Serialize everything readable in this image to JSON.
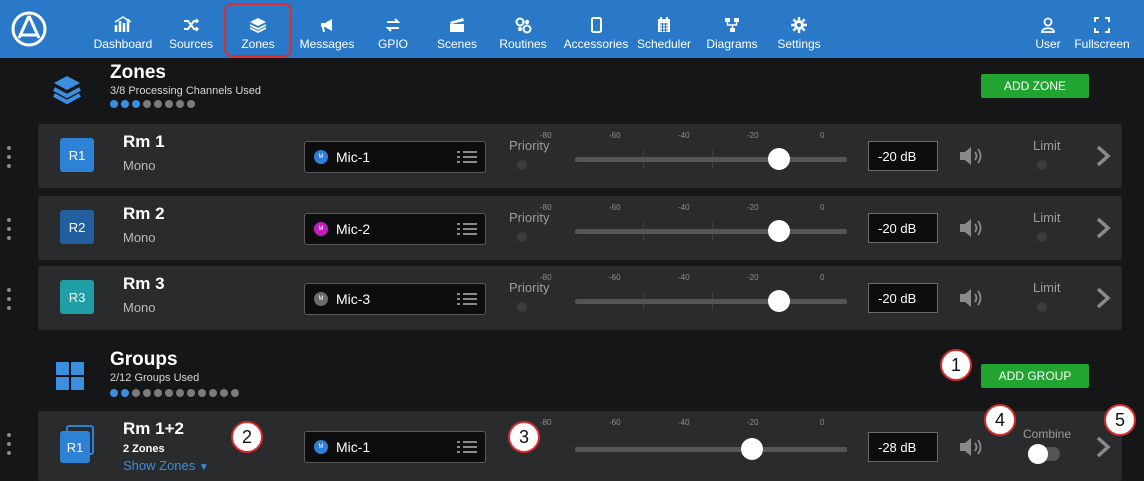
{
  "nav": {
    "items": [
      {
        "label": "Dashboard",
        "icon": "dashboard-icon"
      },
      {
        "label": "Sources",
        "icon": "sources-icon"
      },
      {
        "label": "Zones",
        "icon": "zones-icon",
        "active": true
      },
      {
        "label": "Messages",
        "icon": "messages-icon"
      },
      {
        "label": "GPIO",
        "icon": "gpio-icon"
      },
      {
        "label": "Scenes",
        "icon": "scenes-icon"
      },
      {
        "label": "Routines",
        "icon": "routines-icon"
      },
      {
        "label": "Accessories",
        "icon": "accessories-icon"
      },
      {
        "label": "Scheduler",
        "icon": "scheduler-icon"
      },
      {
        "label": "Diagrams",
        "icon": "diagrams-icon"
      },
      {
        "label": "Settings",
        "icon": "settings-icon"
      }
    ],
    "user": {
      "label": "User",
      "icon": "user-icon"
    },
    "fullscreen": {
      "label": "Fullscreen",
      "icon": "fullscreen-icon"
    }
  },
  "zones": {
    "title": "Zones",
    "subtitle": "3/8 Processing Channels Used",
    "used": 3,
    "total": 8,
    "add_label": "ADD ZONE",
    "priority_label": "Priority",
    "limit_label": "Limit",
    "scale": [
      "-80",
      "-60",
      "-40",
      "-20",
      "0"
    ],
    "rows": [
      {
        "badge": "R1",
        "name": "Rm 1",
        "mode": "Mono",
        "source": "Mic-1",
        "source_tag": "M",
        "source_color": "#2f7fd8",
        "badge_color": "#2d82d6",
        "level": "-20 dB",
        "fader_fraction": 0.75
      },
      {
        "badge": "R2",
        "name": "Rm 2",
        "mode": "Mono",
        "source": "Mic-2",
        "source_tag": "M",
        "source_color": "#c11dbd",
        "badge_color": "#235f9e",
        "level": "-20 dB",
        "fader_fraction": 0.75
      },
      {
        "badge": "R3",
        "name": "Rm 3",
        "mode": "Mono",
        "source": "Mic-3",
        "source_tag": "M",
        "source_color": "#6b6b6b",
        "badge_color": "#1f9ea6",
        "level": "-20 dB",
        "fader_fraction": 0.75
      }
    ]
  },
  "groups": {
    "title": "Groups",
    "subtitle": "2/12 Groups Used",
    "used": 2,
    "total": 12,
    "add_label": "ADD GROUP",
    "row": {
      "badge": "R1",
      "name": "Rm 1+2",
      "count": "2 Zones",
      "show_zones": "Show Zones",
      "source": "Mic-1",
      "source_tag": "M",
      "source_color": "#2f7fd8",
      "badge_color": "#2d82d6",
      "level": "-28 dB",
      "fader_fraction": 0.65,
      "combine_label": "Combine"
    }
  },
  "callouts": [
    "1",
    "2",
    "3",
    "4",
    "5"
  ],
  "accent": "#2a78c8",
  "green": "#21a530"
}
